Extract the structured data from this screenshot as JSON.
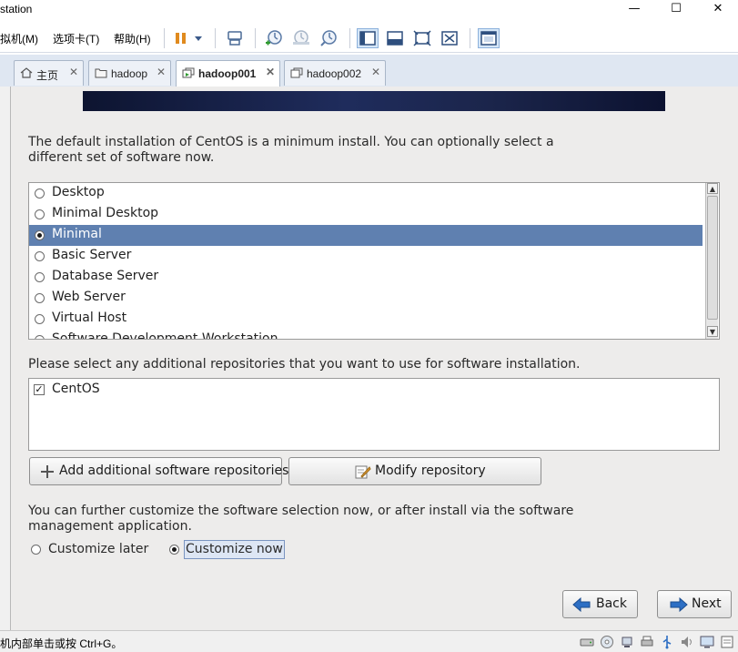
{
  "window": {
    "title": "station",
    "controls": {
      "minimize": "—",
      "maximize": "☐",
      "close": "✕"
    }
  },
  "menu": {
    "vm": "拟机(M)",
    "tabs": "选项卡(T)",
    "help": "帮助(H)"
  },
  "toolbar": {
    "icons": [
      "pause-icon",
      "dropdown-arrow-icon",
      "send-keys-icon",
      "snapshot-take-icon",
      "snapshot-revert-icon",
      "snapshot-manager-icon",
      "show-library-icon",
      "thumbnail-bar-icon",
      "full-screen-icon",
      "unity-icon",
      "console-view-icon"
    ],
    "accent": "#e08a1e"
  },
  "tabs": [
    {
      "label": "主页",
      "icon": "home-icon",
      "close": "✕",
      "selected": false
    },
    {
      "label": "hadoop",
      "icon": "folder-icon",
      "close": "✕",
      "selected": false
    },
    {
      "label": "hadoop001",
      "icon": "vm-icon",
      "close": "✕",
      "selected": true
    },
    {
      "label": "hadoop002",
      "icon": "vm-icon",
      "close": "✕",
      "selected": false
    }
  ],
  "installer": {
    "intro_line1": "The default installation of CentOS is a minimum install. You can optionally select a",
    "intro_line2": "different set of software now.",
    "software_sets": [
      {
        "label": "Desktop",
        "selected": false
      },
      {
        "label": "Minimal Desktop",
        "selected": false
      },
      {
        "label": "Minimal",
        "selected": true
      },
      {
        "label": "Basic Server",
        "selected": false
      },
      {
        "label": "Database Server",
        "selected": false
      },
      {
        "label": "Web Server",
        "selected": false
      },
      {
        "label": "Virtual Host",
        "selected": false
      },
      {
        "label": "Software Development Workstation",
        "selected": false
      }
    ],
    "repos_prompt": "Please select any additional repositories that you want to use for software installation.",
    "repositories": [
      {
        "label": "CentOS",
        "checked": true,
        "mark": "✓"
      }
    ],
    "add_repo_button": "Add additional software repositories",
    "modify_repo_button": "Modify repository",
    "customize_line1": "You can further customize the software selection now, or after install via the software",
    "customize_line2": "management application.",
    "customize_later": "Customize later",
    "customize_now": "Customize now",
    "customize_choice": "now",
    "back_button": "Back",
    "next_button": "Next",
    "selection_color": "#5f80b0"
  },
  "statusbar": {
    "hint": "机内部单击或按 Ctrl+G。",
    "devices": [
      "hard-disk-icon",
      "cd-dvd-icon",
      "network-adapter-icon",
      "usb-controller-icon",
      "printer-icon",
      "sound-card-icon",
      "display-icon",
      "message-log-icon"
    ]
  }
}
